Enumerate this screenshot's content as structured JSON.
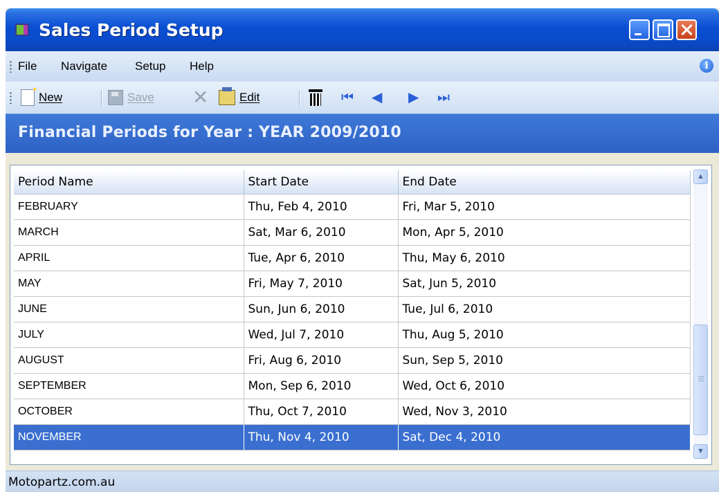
{
  "window": {
    "title": "Sales Period Setup"
  },
  "menu": {
    "items": [
      "File",
      "Navigate",
      "Setup",
      "Help"
    ]
  },
  "toolbar": {
    "new_label": "New",
    "save_label": "Save",
    "edit_label": "Edit"
  },
  "header": {
    "title": "Financial Periods for Year : YEAR 2009/2010"
  },
  "grid": {
    "columns": [
      "Period Name",
      "Start Date",
      "End Date"
    ],
    "rows": [
      [
        "FEBRUARY",
        "Thu, Feb 4, 2010",
        "Fri, Mar 5, 2010"
      ],
      [
        "MARCH",
        "Sat, Mar 6, 2010",
        "Mon, Apr 5, 2010"
      ],
      [
        "APRIL",
        "Tue, Apr 6, 2010",
        "Thu, May 6, 2010"
      ],
      [
        "MAY",
        "Fri, May 7, 2010",
        "Sat, Jun 5, 2010"
      ],
      [
        "JUNE",
        "Sun, Jun 6, 2010",
        "Tue, Jul 6, 2010"
      ],
      [
        "JULY",
        "Wed, Jul 7, 2010",
        "Thu, Aug 5, 2010"
      ],
      [
        "AUGUST",
        "Fri, Aug 6, 2010",
        "Sun, Sep 5, 2010"
      ],
      [
        "SEPTEMBER",
        "Mon, Sep 6, 2010",
        "Wed, Oct 6, 2010"
      ],
      [
        "OCTOBER",
        "Thu, Oct 7, 2010",
        "Wed, Nov 3, 2010"
      ],
      [
        "NOVEMBER",
        "Thu, Nov 4, 2010",
        "Sat, Dec 4, 2010"
      ]
    ],
    "selected_row": "NOVEMBER"
  },
  "status": {
    "text": "Motopartz.com.au"
  },
  "colors": {
    "title_bar": "#0a4ed2",
    "header_band": "#3a6fd0",
    "selection": "#3a6fd0"
  }
}
